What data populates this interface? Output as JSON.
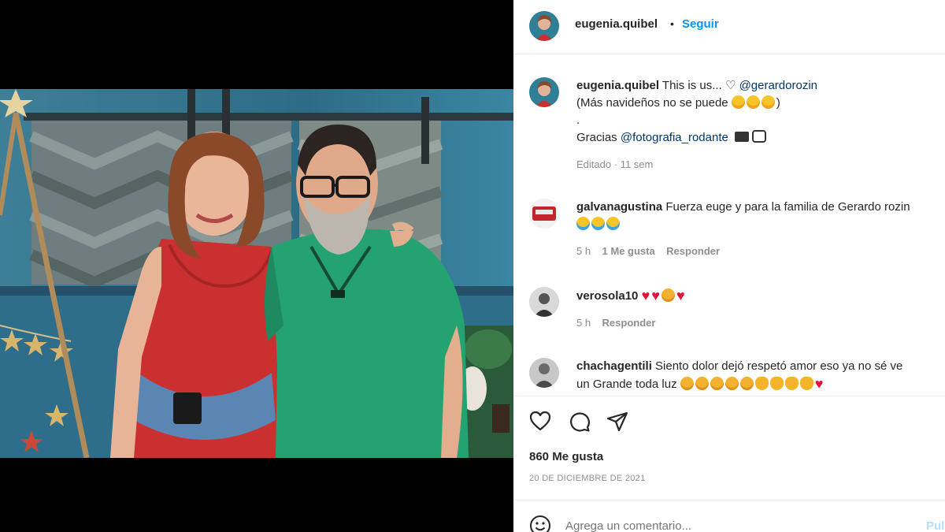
{
  "post": {
    "username": "eugenia.quibel",
    "separator": "•",
    "follow_label": "Seguir"
  },
  "caption": {
    "username": "eugenia.quibel",
    "text_start": "This is us... ♡ ",
    "mention_1": "@gerardorozin",
    "line2": "(Más navideños no se puede",
    "line2_end": ")",
    "line3": ".",
    "line4_start": "Gracias ",
    "mention_2": "@fotografia_rodante",
    "edited": "Editado",
    "dot": "·",
    "time": "11 sem"
  },
  "comments": [
    {
      "username": "galvanagustina",
      "text": "Fuerza euge y para la familia de Gerardo rozin",
      "time": "5 h",
      "likes": "1 Me gusta",
      "reply": "Responder"
    },
    {
      "username": "verosola10",
      "time": "5 h",
      "reply": "Responder"
    },
    {
      "username": "chachagentili",
      "text_line1": "Siento dolor dejó respetó amor eso ya no sé ve",
      "text_line2": "un Grande toda luz"
    }
  ],
  "actions": {
    "likes": "860 Me gusta",
    "date": "20 DE DICIEMBRE DE 2021"
  },
  "add_comment": {
    "placeholder": "Agrega un comentario...",
    "publish": "Pul"
  },
  "icons": {
    "like": "heart-outline-icon",
    "comment": "comment-bubble-icon",
    "share": "paper-plane-icon",
    "emoji": "smiley-icon"
  },
  "colors": {
    "follow": "#0095f6",
    "mention": "#00376b",
    "muted": "#8e8e8e"
  }
}
